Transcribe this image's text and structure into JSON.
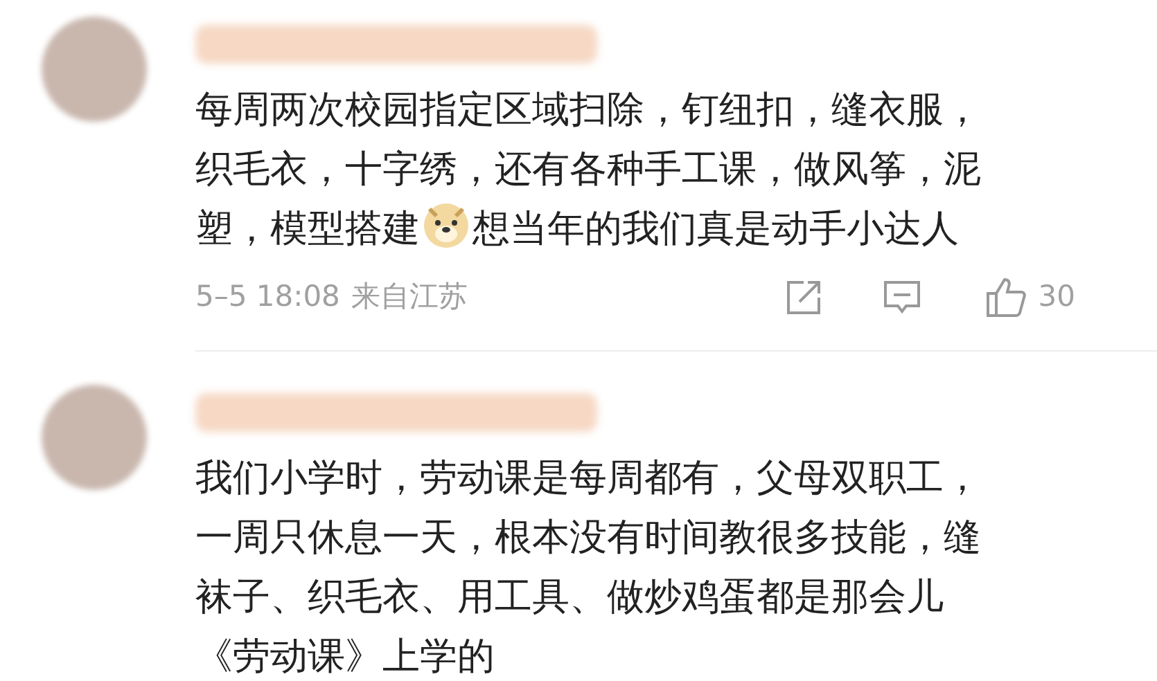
{
  "comments": [
    {
      "lines": [
        [
          {
            "kind": "text",
            "text": "每周两次校园指定区域扫除，钉纽扣，缝衣服，"
          }
        ],
        [
          {
            "kind": "text",
            "text": "织毛衣，十字绣，还有各种手工课，做风筝，泥"
          }
        ],
        [
          {
            "kind": "text",
            "text": "塑，模型搭建"
          },
          {
            "kind": "emoji"
          },
          {
            "kind": "text",
            "text": "想当年的我们真是动手小达人"
          }
        ]
      ],
      "time": "5–5 18:08",
      "location": "来自江苏",
      "like_count": "30"
    },
    {
      "lines": [
        [
          {
            "kind": "text",
            "text": "我们小学时，劳动课是每周都有，父母双职工，"
          }
        ],
        [
          {
            "kind": "text",
            "text": "一周只休息一天，根本没有时间教很多技能，缝"
          }
        ],
        [
          {
            "kind": "text",
            "text": "袜子、织毛衣、用工具、做炒鸡蛋都是那会儿"
          }
        ],
        [
          {
            "kind": "text",
            "text": "《劳动课》上学的"
          }
        ]
      ]
    }
  ]
}
